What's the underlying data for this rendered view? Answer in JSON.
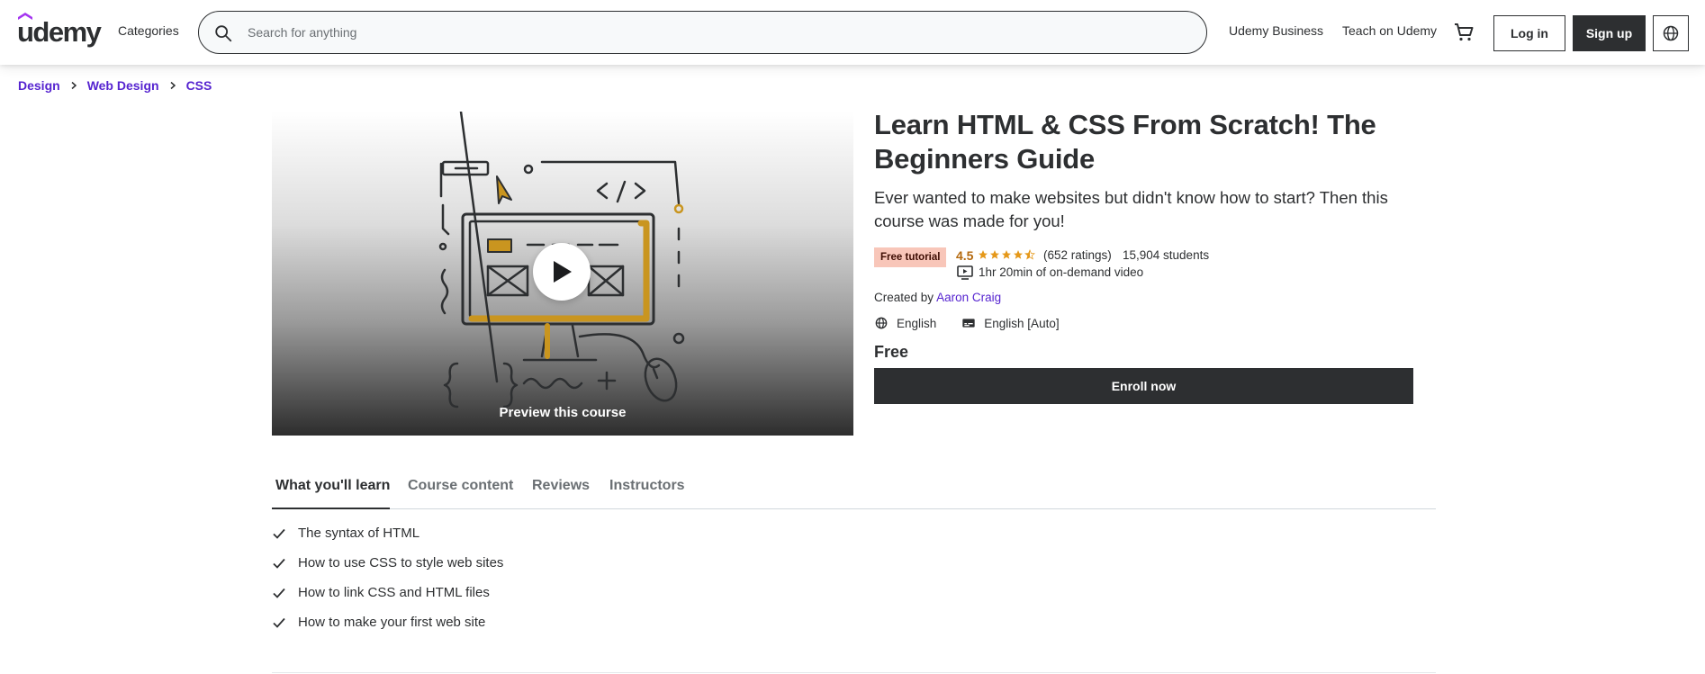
{
  "header": {
    "logo_text": "udemy",
    "categories_label": "Categories",
    "search_placeholder": "Search for anything",
    "udemy_business_label": "Udemy Business",
    "teach_label": "Teach on Udemy",
    "login_label": "Log in",
    "signup_label": "Sign up",
    "icons": [
      "search-icon",
      "cart-icon",
      "globe-icon"
    ]
  },
  "breadcrumb": [
    "Design",
    "Web Design",
    "CSS"
  ],
  "preview": {
    "label": "Preview this course"
  },
  "course": {
    "title": "Learn HTML & CSS From Scratch! The Beginners Guide",
    "subtitle": "Ever wanted to make websites but didn't know how to start? Then this course was made for you!",
    "badge": "Free tutorial",
    "rating": "4.5",
    "stars_value": 4.5,
    "ratings_count": "(652 ratings)",
    "students": "15,904 students",
    "video_length": "1hr 20min of on-demand video",
    "created_by_label": "Created by",
    "instructor": "Aaron Craig",
    "language": "English",
    "captions": "English [Auto]",
    "price": "Free",
    "enroll_label": "Enroll now"
  },
  "tabs": [
    "What you'll learn",
    "Course content",
    "Reviews",
    "Instructors"
  ],
  "learn_items": [
    "The syntax of HTML",
    "How to use CSS to style web sites",
    "How to link CSS and HTML files",
    "How to make your first web site"
  ],
  "colors": {
    "brand_purple": "#5624d0",
    "dark": "#2d2f31",
    "rating_orange": "#b4690e",
    "badge_bg": "#f8c6b9",
    "star": "#e59819"
  }
}
